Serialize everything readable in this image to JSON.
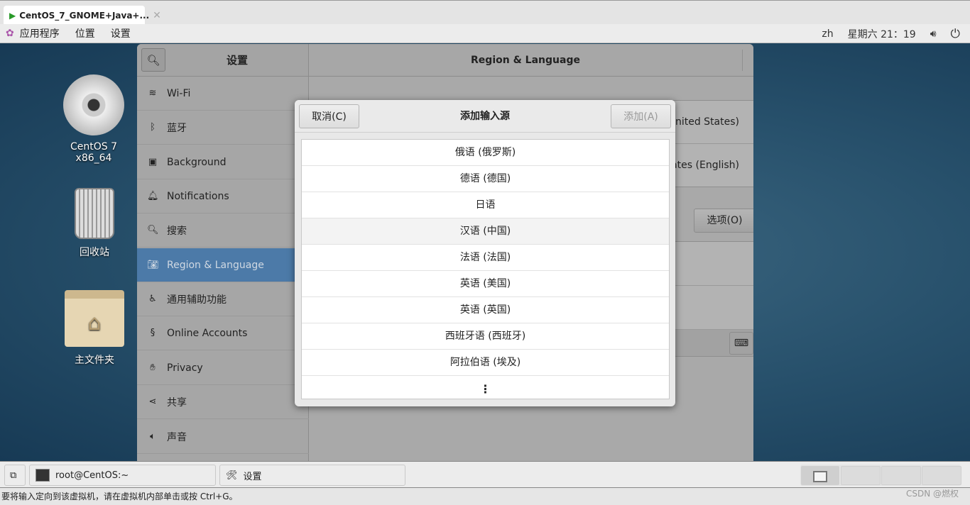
{
  "vm_tab": {
    "title": "CentOS_7_GNOME+Java+...",
    "close": "✕"
  },
  "top_panel": {
    "menus": [
      "应用程序",
      "位置",
      "设置"
    ],
    "input_method": "zh",
    "clock": "星期六  21：19"
  },
  "desktop": {
    "icons": [
      {
        "label": "CentOS 7 x86_64"
      },
      {
        "label": "回收站"
      },
      {
        "label": "主文件夹"
      }
    ]
  },
  "settings": {
    "sidebar_title": "设置",
    "window_title": "Region & Language",
    "sidebar_items": [
      {
        "label": "Wi-Fi",
        "icon": "wifi-icon"
      },
      {
        "label": "蓝牙",
        "icon": "bluetooth-icon"
      },
      {
        "label": "Background",
        "icon": "background-icon"
      },
      {
        "label": "Notifications",
        "icon": "bell-icon"
      },
      {
        "label": "搜索",
        "icon": "search-icon"
      },
      {
        "label": "Region & Language",
        "icon": "camera-icon",
        "selected": true
      },
      {
        "label": "通用辅助功能",
        "icon": "accessibility-icon"
      },
      {
        "label": "Online Accounts",
        "icon": "online-accounts-icon"
      },
      {
        "label": "Privacy",
        "icon": "hand-icon"
      },
      {
        "label": "共享",
        "icon": "share-icon"
      },
      {
        "label": "声音",
        "icon": "speaker-icon"
      }
    ],
    "main": {
      "language_value": "United States)",
      "formats_value": "tates (English)",
      "options_button": "选项(O)"
    }
  },
  "dialog": {
    "title": "添加输入源",
    "cancel": "取消(C)",
    "add": "添加(A)",
    "items": [
      "俄语 (俄罗斯)",
      "德语 (德国)",
      "日语",
      "汉语 (中国)",
      "法语 (法国)",
      "英语 (美国)",
      "英语 (英国)",
      "西班牙语 (西班牙)",
      "阿拉伯语 (埃及)"
    ],
    "more": "⋮"
  },
  "taskbar": {
    "items": [
      "root@CentOS:~",
      "设置"
    ]
  },
  "status_bar": {
    "text": "要将输入定向到该虚拟机，请在虚拟机内部单击或按 Ctrl+G。",
    "watermark": "CSDN @燃权"
  },
  "colors": {
    "selection": "#4c7aa8",
    "desktop": "#27506b"
  }
}
